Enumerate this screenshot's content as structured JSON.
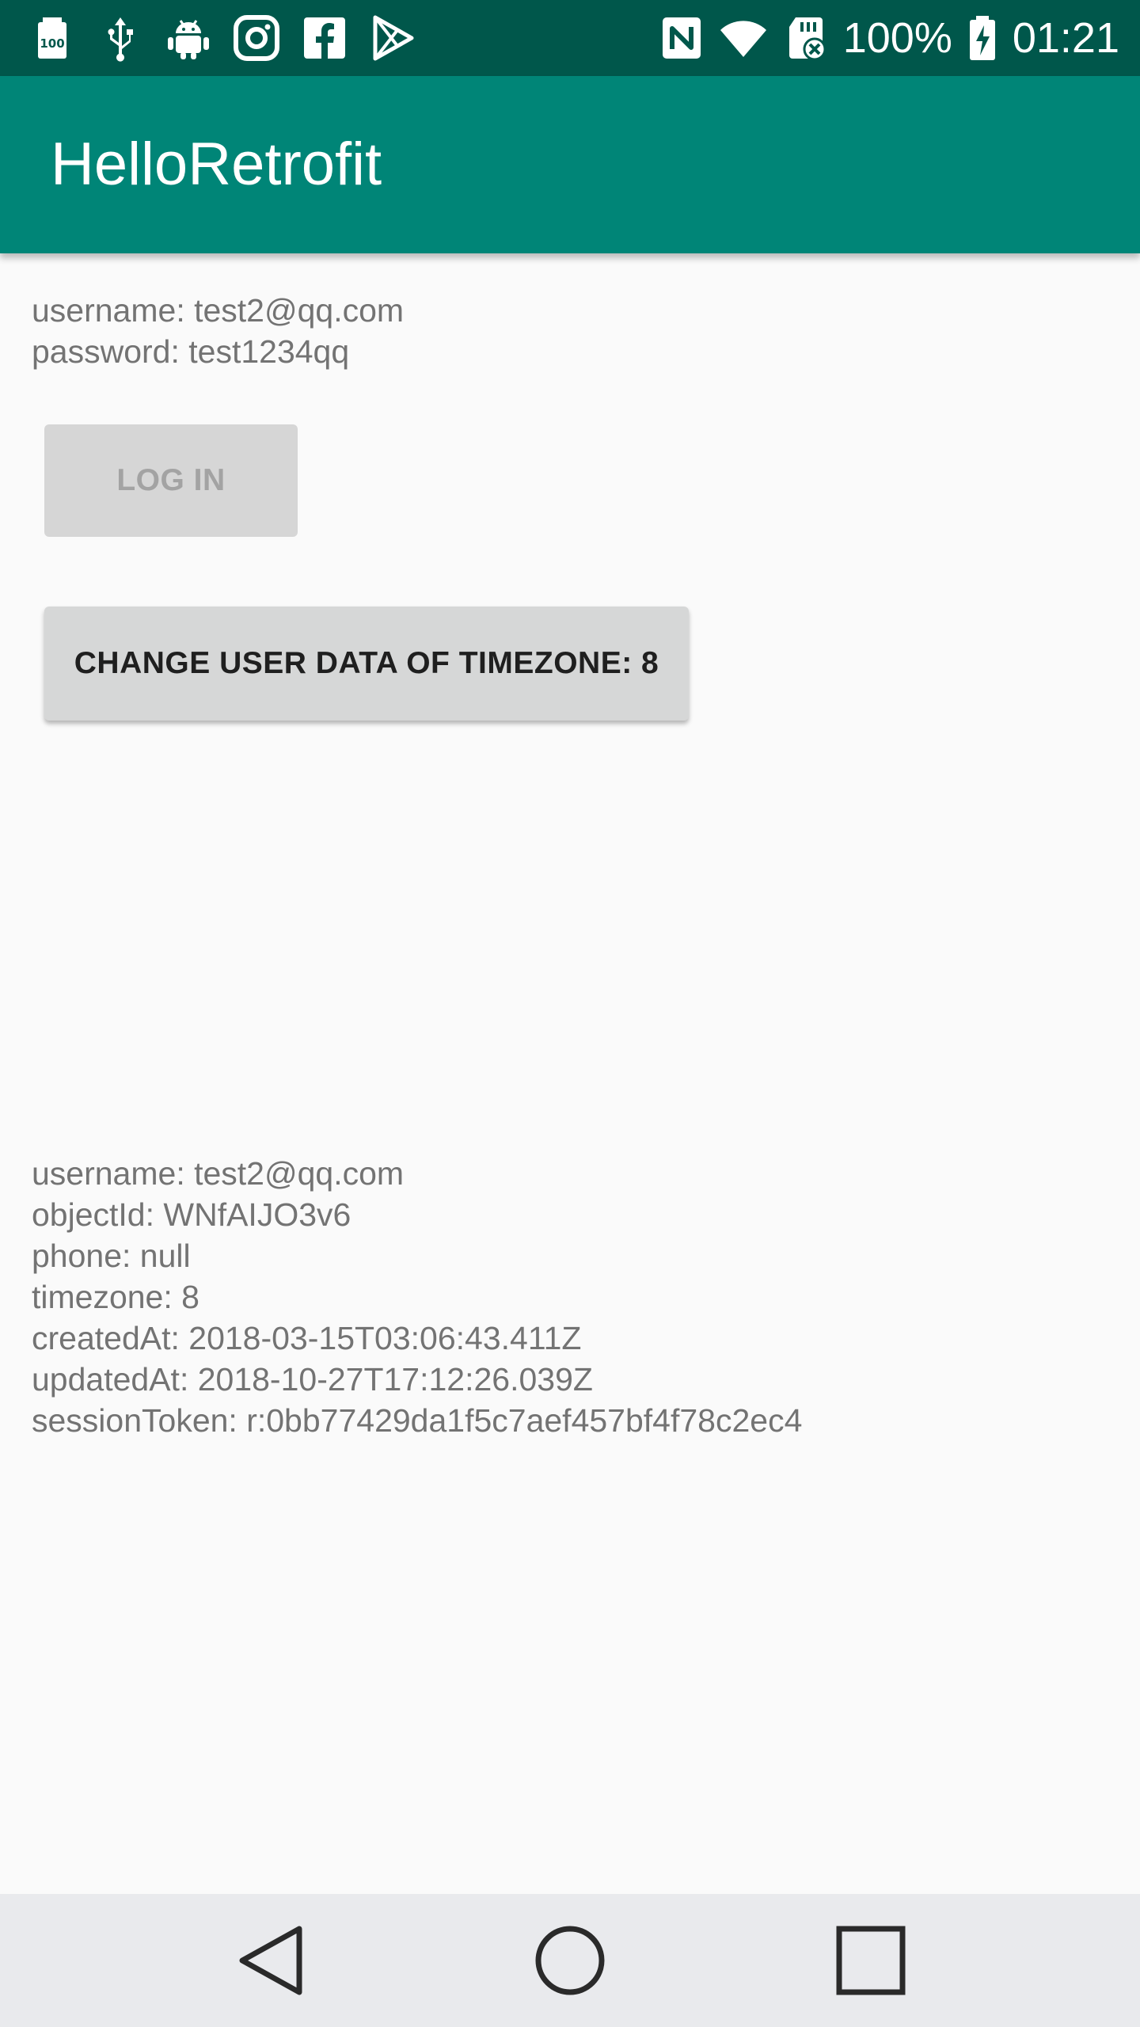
{
  "status_bar": {
    "battery_percent": "100%",
    "time": "01:21",
    "left_icons": [
      "battery-saver-icon",
      "usb-icon",
      "android-debug-icon",
      "instagram-icon",
      "facebook-icon",
      "play-store-icon"
    ],
    "right_icons": [
      "nfc-icon",
      "wifi-icon",
      "sd-card-icon",
      "battery-charging-icon"
    ]
  },
  "app_bar": {
    "title": "HelloRetrofit"
  },
  "credentials": {
    "username_line": "username: test2@qq.com",
    "password_line": "password: test1234qq"
  },
  "buttons": {
    "login_label": "LOG IN",
    "change_label": "CHANGE USER DATA OF TIMEZONE: 8"
  },
  "user_info": {
    "lines": [
      "username: test2@qq.com",
      "objectId: WNfAIJO3v6",
      "phone: null",
      "timezone: 8",
      "createdAt: 2018-03-15T03:06:43.411Z",
      "updatedAt: 2018-10-27T17:12:26.039Z",
      "sessionToken: r:0bb77429da1f5c7aef457bf4f78c2ec4"
    ]
  },
  "nav_bar": {
    "icons": [
      "back-icon",
      "home-icon",
      "recents-icon"
    ]
  },
  "colors": {
    "status_bar": "#00574b",
    "app_bar": "#008577",
    "background": "#fafafa",
    "nav_bar": "#e9eaed"
  }
}
